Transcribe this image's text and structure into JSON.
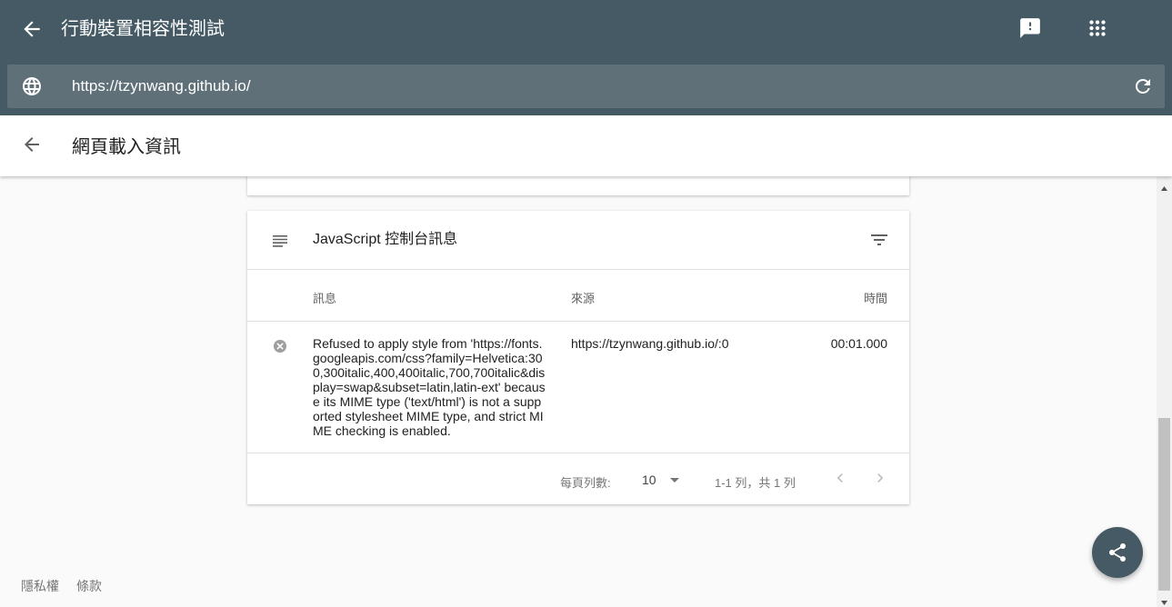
{
  "app": {
    "title": "行動裝置相容性測試"
  },
  "urlbar": {
    "url": "https://tzynwang.github.io/"
  },
  "subheader": {
    "title": "網頁載入資訊"
  },
  "console_card": {
    "title": "JavaScript 控制台訊息",
    "columns": {
      "message": "訊息",
      "source": "來源",
      "time": "時間"
    },
    "rows": [
      {
        "message": "Refused to apply style from 'https://fonts.googleapis.com/css?family=Helvetica:300,300italic,400,400italic,700,700italic&display=swap&subset=latin,latin-ext' because its MIME type ('text/html') is not a supported stylesheet MIME type, and strict MIME checking is enabled.",
        "source": "https://tzynwang.github.io/:0",
        "time": "00:01.000",
        "level_icon": "error-icon"
      }
    ],
    "pagination": {
      "rows_per_page_label": "每頁列數:",
      "rows_per_page_value": "10",
      "range_text": "1-1 列，共 1 列"
    }
  },
  "footer": {
    "privacy": "隱私權",
    "terms": "條款"
  },
  "colors": {
    "header_bg": "#455a64",
    "urlbar_bg": "#607079",
    "page_bg": "#fafafa",
    "fab_bg": "#455a64"
  }
}
